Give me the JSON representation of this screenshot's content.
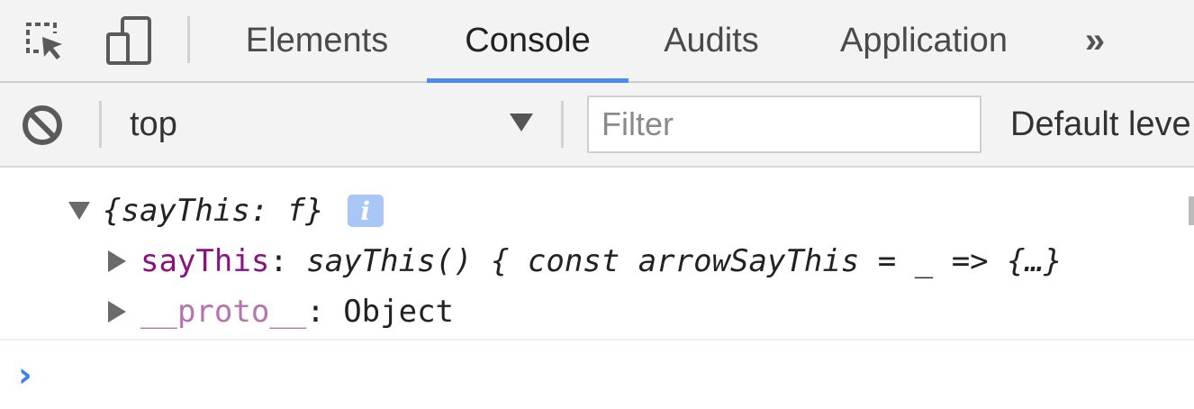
{
  "tabbar": {
    "icons": [
      "inspect-element-icon",
      "device-toolbar-icon"
    ],
    "tabs": [
      {
        "label": "Elements",
        "active": false
      },
      {
        "label": "Console",
        "active": true
      },
      {
        "label": "Audits",
        "active": false
      },
      {
        "label": "Application",
        "active": false
      }
    ],
    "more_label": "»",
    "accent": "#4b8cf0"
  },
  "toolbar": {
    "clear_icon": "clear-console-icon",
    "context": "top",
    "filter_placeholder": "Filter",
    "filter_value": "",
    "levels_label": "Default leve"
  },
  "console": {
    "object_preview": "{sayThis: f}",
    "info_badge": "i",
    "entries": [
      {
        "key": "sayThis",
        "sep": ": ",
        "value": "sayThis() { const arrowSayThis = _ => {…}"
      },
      {
        "key": "__proto__",
        "sep": ": ",
        "value": "Object"
      }
    ],
    "prompt_symbol": "›",
    "prompt_color": "#3b7ff0",
    "property_color": "#881280"
  }
}
